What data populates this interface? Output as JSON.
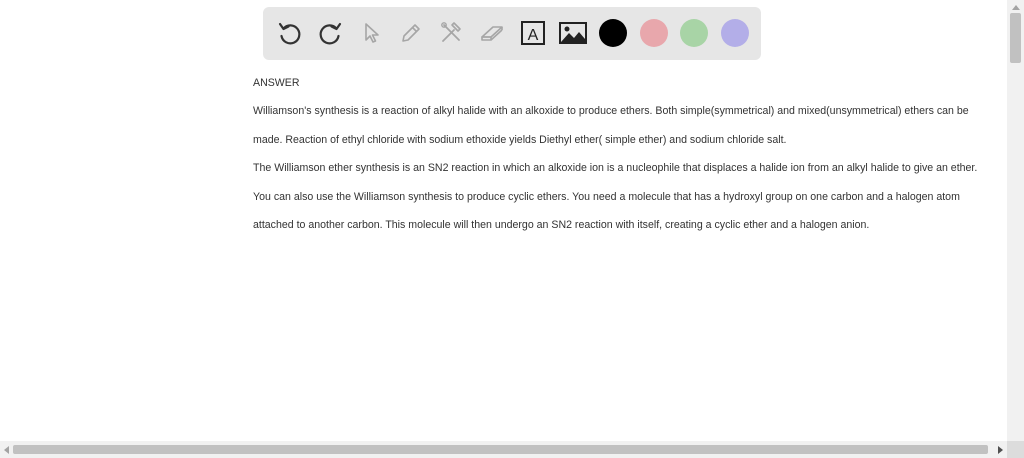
{
  "toolbar": {
    "tools": [
      {
        "name": "undo-icon",
        "enabled": true
      },
      {
        "name": "redo-icon",
        "enabled": true
      },
      {
        "name": "pointer-icon",
        "enabled": false
      },
      {
        "name": "pencil-icon",
        "enabled": false
      },
      {
        "name": "tools-icon",
        "enabled": false
      },
      {
        "name": "eraser-icon",
        "enabled": false
      },
      {
        "name": "text-box-icon",
        "enabled": true
      },
      {
        "name": "image-icon",
        "enabled": true
      }
    ],
    "colors": [
      "#000000",
      "#e8a7ac",
      "#a8d4a6",
      "#b3aee8"
    ],
    "text_tool_letter": "A"
  },
  "content": {
    "heading": "ANSWER",
    "lines": [
      "Williamson's synthesis is a reaction of alkyl halide with an alkoxide to produce ethers. Both simple(symmetrical) and mixed(unsymmetrical) ethers can be",
      " made. Reaction of ethyl chloride with sodium ethoxide yields Diethyl ether( simple ether) and sodium chloride salt.",
      "The Williamson ether synthesis is an SN2 reaction in which an alkoxide ion is a nucleophile that displaces a halide ion from an alkyl halide to give an ether.",
      "You can also use the Williamson synthesis to produce cyclic ethers. You need a molecule that has a hydroxyl group on one carbon and a halogen atom",
      " attached to another carbon. This molecule will then undergo an SN2 reaction with itself, creating a cyclic ether and a halogen anion."
    ]
  }
}
